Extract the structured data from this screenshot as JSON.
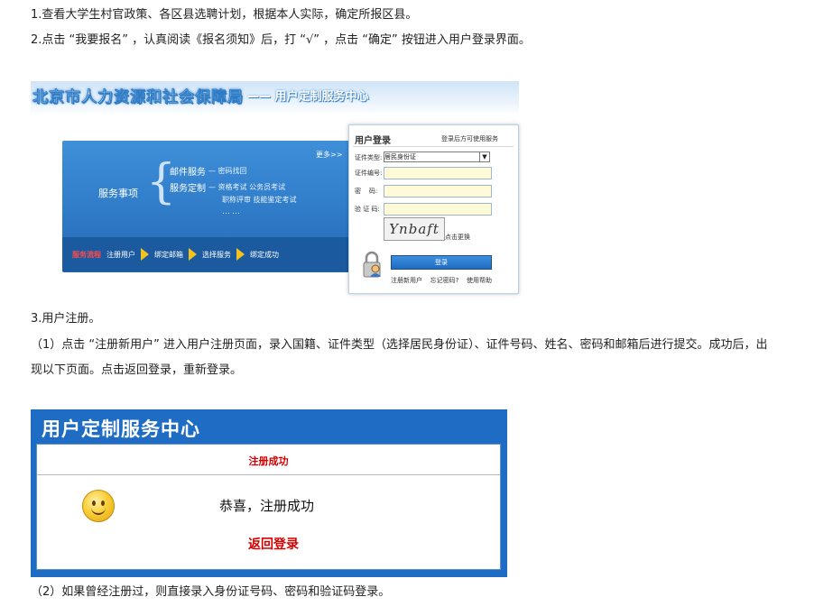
{
  "steps": {
    "s1": "1.查看大学生村官政策、各区县选聘计划，根据本人实际，确定所报区县。",
    "s2": "2.点击 “我要报名” ，认真阅读《报名须知》后，打 “√” ，点击 “确定” 按钮进入用户登录界面。",
    "s3": "3.用户注册。",
    "s3_1a": "（1）点击 “注册新用户” 进入用户注册页面，录入国籍、证件类型（选择居民身份证）、证件号码、姓名、密码和邮箱后进行提交。成功后，出",
    "s3_1b": "现以下页面。点击返回登录，重新登录。",
    "s3_2": "（2）如果曾经注册过，则直接录入身份证号码、密码和验证码登录。"
  },
  "portal": {
    "title": "北京市人力资源和社会保障局",
    "subtitle": "—— 用户定制服务中心",
    "more": "更多>>",
    "services_label": "服务事项",
    "brace": "{",
    "mail_service": "邮件服务",
    "mail_detail": "— 密码找回",
    "custom_service": "服务定制",
    "custom_detail1": "— 资格考试  公务员考试",
    "custom_detail2": "职称评审  技能鉴定考试",
    "ellipsis": "……",
    "flow": [
      "服务流程",
      "注册用户",
      "绑定邮箱",
      "选择服务",
      "绑定成功"
    ]
  },
  "login": {
    "heading": "用户登录",
    "hint": "登录后方可使用服务",
    "id_type_label": "证件类型:",
    "id_type_value": "居民身份证",
    "id_no_label": "证件编号:",
    "password_label": "密    码:",
    "captcha_label": "验 证 码:",
    "captcha_text": "Ynbaft",
    "refresh": "点击更换",
    "login_button": "登录",
    "register_link": "注册新用户",
    "forgot_link": "忘记密码?",
    "help_link": "使用帮助"
  },
  "success": {
    "title": "用户定制服务中心",
    "header": "注册成功",
    "message": "恭喜，注册成功",
    "back": "返回登录"
  },
  "colors": {
    "portal_blue": "#2f7bc8",
    "success_red": "#d60000",
    "flow_arrow": "#f4c21a"
  }
}
